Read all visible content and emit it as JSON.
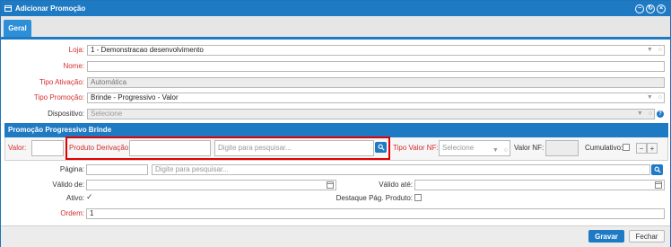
{
  "window": {
    "title": "Adicionar Promoção"
  },
  "tabs": [
    {
      "label": "Geral"
    }
  ],
  "form": {
    "loja": {
      "label": "Loja:",
      "value": "1 - Demonstracao desenvolvimento"
    },
    "nome": {
      "label": "Nome:",
      "value": ""
    },
    "tipo_ativacao": {
      "label": "Tipo Ativação:",
      "value": "Automática"
    },
    "tipo_promocao": {
      "label": "Tipo Promoção:",
      "value": "Brinde - Progressivo - Valor"
    },
    "dispositivo": {
      "label": "Dispositivo:",
      "placeholder": "Selecione"
    }
  },
  "section": {
    "title": "Promoção Progressivo Brinde",
    "valor": {
      "label": "Valor:",
      "value": ""
    },
    "produto_derivacao": {
      "label": "Produto Derivação:",
      "value": "",
      "search_placeholder": "Digite para pesquisar..."
    },
    "tipo_valor_nf": {
      "label": "Tipo Valor NF:",
      "placeholder": "Selecione"
    },
    "valor_nf": {
      "label": "Valor NF:",
      "value": ""
    },
    "cumulativo": {
      "label": "Cumulativo:",
      "checked": false
    },
    "stepper": {
      "minus": "−",
      "plus": "+"
    }
  },
  "form2": {
    "pagina": {
      "label": "Página:",
      "value": "",
      "search_placeholder": "Digite para pesquisar..."
    },
    "valido_de": {
      "label": "Válido de:",
      "value": ""
    },
    "valido_ate": {
      "label": "Válido até:",
      "value": ""
    },
    "ativo": {
      "label": "Ativo:",
      "checked": true,
      "mark": "✓"
    },
    "destaque": {
      "label": "Destaque Pág. Produto:",
      "checked": false
    },
    "ordem": {
      "label": "Ordem:",
      "value": "1"
    }
  },
  "footer": {
    "save": "Gravar",
    "close": "Fechar"
  },
  "icons": {
    "caret": "▼",
    "clear": "○",
    "help": "?"
  },
  "colors": {
    "accent": "#1f7ac4",
    "required": "#d32f2f",
    "highlight": "#e00000"
  }
}
